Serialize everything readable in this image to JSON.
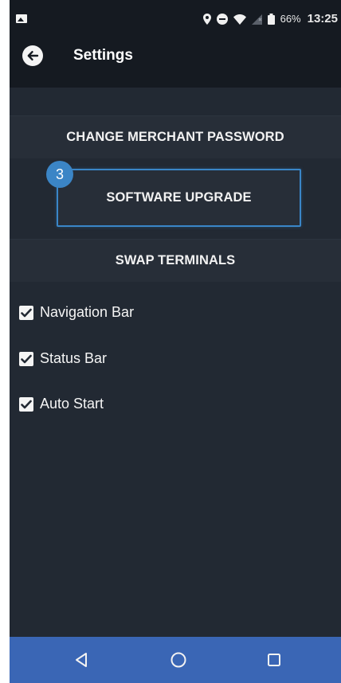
{
  "status_bar": {
    "battery_text": "66%",
    "time": "13:25",
    "icons": [
      "gallery-icon",
      "location-icon",
      "dnd-icon",
      "wifi-icon",
      "signal-icon",
      "battery-icon"
    ]
  },
  "header": {
    "title": "Settings",
    "back_icon": "arrow-left-icon"
  },
  "settings_buttons": [
    {
      "label": "CHANGE MERCHANT PASSWORD"
    },
    {
      "label": "SOFTWARE UPGRADE"
    },
    {
      "label": "SWAP TERMINALS"
    }
  ],
  "step_badge": "3",
  "toggles": [
    {
      "label": "Navigation Bar",
      "checked": true
    },
    {
      "label": "Status Bar",
      "checked": true
    },
    {
      "label": "Auto Start",
      "checked": true
    }
  ],
  "nav_bar": {
    "icons": [
      "back-triangle-icon",
      "home-circle-icon",
      "recents-square-icon"
    ]
  },
  "colors": {
    "background": "#222933",
    "header": "#151a21",
    "accent": "#3b85c6",
    "nav_bar": "#3a66b5"
  }
}
